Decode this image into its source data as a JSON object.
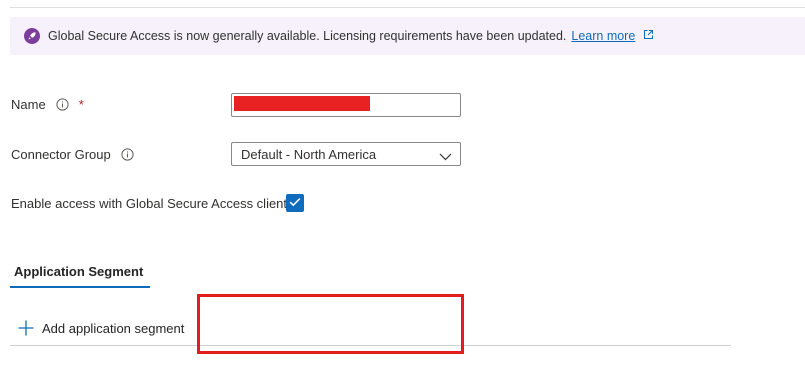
{
  "banner": {
    "icon": "rocket-icon",
    "text": "Global Secure Access is now generally available. Licensing requirements have been updated.",
    "link_label": "Learn more",
    "link_icon": "external-link-icon"
  },
  "form": {
    "name": {
      "label": "Name",
      "required_marker": "*",
      "value": ""
    },
    "connector_group": {
      "label": "Connector Group",
      "selected": "Default - North America"
    },
    "enable_access": {
      "label": "Enable access with Global Secure Access client",
      "checked": true
    }
  },
  "tabs": [
    {
      "label": "Application Segment",
      "active": true
    }
  ],
  "actions": {
    "add_segment_label": "Add application segment"
  },
  "colors": {
    "accent": "#0f6cbd",
    "banner_bg": "#f6f1fa",
    "banner_icon": "#7c3e9a",
    "required": "#a4262c",
    "annotation_red": "#e11d1d"
  }
}
